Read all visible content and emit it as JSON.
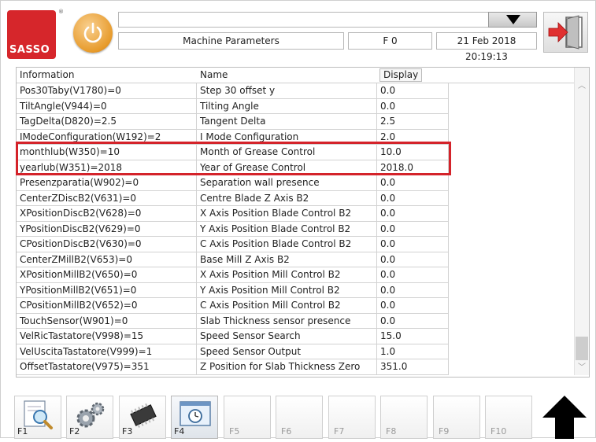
{
  "header": {
    "logo_text": "SASSO",
    "title": "Machine Parameters",
    "mode": "F 0",
    "datetime": "21 Feb 2018 20:19:13"
  },
  "table": {
    "columns": [
      "Information",
      "Name",
      "Display"
    ],
    "rows": [
      {
        "info": "Pos30Taby(V1780)=0",
        "name": "Step 30 offset y",
        "display": "0.0"
      },
      {
        "info": "TiltAngle(V944)=0",
        "name": "Tilting Angle",
        "display": "0.0"
      },
      {
        "info": "TagDelta(D820)=2.5",
        "name": "Tangent Delta",
        "display": "2.5"
      },
      {
        "info": "IModeConfiguration(W192)=2",
        "name": "I Mode Configuration",
        "display": "2.0"
      },
      {
        "info": "monthlub(W350)=10",
        "name": "Month of Grease Control",
        "display": "10.0"
      },
      {
        "info": "yearlub(W351)=2018",
        "name": "Year of Grease Control",
        "display": "2018.0"
      },
      {
        "info": "Presenzparatia(W902)=0",
        "name": "Separation wall presence",
        "display": "0.0"
      },
      {
        "info": "CenterZDiscB2(V631)=0",
        "name": "Centre Blade Z Axis B2",
        "display": "0.0"
      },
      {
        "info": "XPositionDiscB2(V628)=0",
        "name": "X Axis Position Blade Control B2",
        "display": "0.0"
      },
      {
        "info": "YPositionDiscB2(V629)=0",
        "name": "Y Axis Position Blade Control B2",
        "display": "0.0"
      },
      {
        "info": "CPositionDiscB2(V630)=0",
        "name": "C Axis Position Blade Control B2",
        "display": "0.0"
      },
      {
        "info": "CenterZMillB2(V653)=0",
        "name": "Base Mill Z Axis B2",
        "display": "0.0"
      },
      {
        "info": "XPositionMillB2(V650)=0",
        "name": "X Axis Position Mill Control B2",
        "display": "0.0"
      },
      {
        "info": "YPositionMillB2(V651)=0",
        "name": "Y Axis Position Mill Control B2",
        "display": "0.0"
      },
      {
        "info": "CPositionMillB2(V652)=0",
        "name": "C Axis Position Mill Control B2",
        "display": "0.0"
      },
      {
        "info": "TouchSensor(W901)=0",
        "name": "Slab Thickness sensor presence",
        "display": "0.0"
      },
      {
        "info": "VelRicTastatore(V998)=15",
        "name": "Speed Sensor Search",
        "display": "15.0"
      },
      {
        "info": "VelUscitaTastatore(V999)=1",
        "name": "Speed Sensor Output",
        "display": "1.0"
      },
      {
        "info": "OffsetTastatore(V975)=351",
        "name": "Z Position for Slab Thickness Zero",
        "display": "351.0"
      }
    ]
  },
  "function_keys": [
    {
      "label": "F1",
      "icon": "magnifier-document-icon",
      "enabled": true
    },
    {
      "label": "F2",
      "icon": "gears-icon",
      "enabled": true
    },
    {
      "label": "F3",
      "icon": "chip-icon",
      "enabled": true
    },
    {
      "label": "F4",
      "icon": "clock-window-icon",
      "enabled": true
    },
    {
      "label": "F5",
      "enabled": false
    },
    {
      "label": "F6",
      "enabled": false
    },
    {
      "label": "F7",
      "enabled": false
    },
    {
      "label": "F8",
      "enabled": false
    },
    {
      "label": "F9",
      "enabled": false
    },
    {
      "label": "F10",
      "enabled": false
    }
  ],
  "icons": {
    "power": "power-icon",
    "exit": "exit-door-icon",
    "dropdown": "triangle-down-icon",
    "up": "up-arrow-icon"
  },
  "colors": {
    "brand_red": "#d6262b",
    "highlight_red": "#d4232a",
    "power_orange": "#e79b2c"
  }
}
